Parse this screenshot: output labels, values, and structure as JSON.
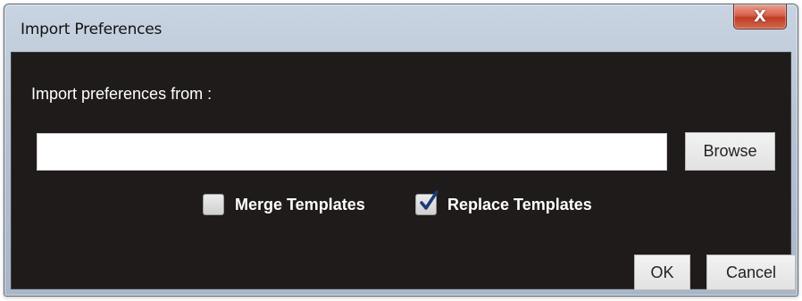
{
  "window": {
    "title": "Import Preferences",
    "close_icon": "close-icon",
    "close_glyph": "X"
  },
  "form": {
    "import_label": "Import preferences from :",
    "path_value": "",
    "path_placeholder": "",
    "browse_label": "Browse"
  },
  "options": {
    "merge": {
      "label": "Merge Templates",
      "checked": false
    },
    "replace": {
      "label": "Replace Templates",
      "checked": true
    }
  },
  "actions": {
    "ok_label": "OK",
    "cancel_label": "Cancel"
  },
  "colors": {
    "panel_background": "#1f1b1a",
    "close_button": "#d9604a",
    "title_bar": "#b7c3d3"
  }
}
